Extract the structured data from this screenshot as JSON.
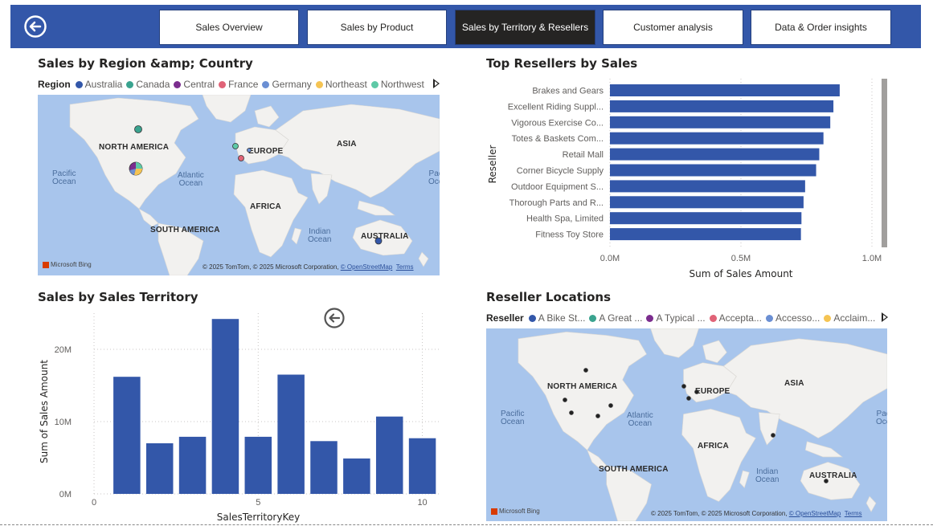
{
  "nav": {
    "tabs": [
      {
        "label": "Sales Overview",
        "active": false
      },
      {
        "label": "Sales by Product",
        "active": false
      },
      {
        "label": "Sales by Territory & Resellers",
        "active": true
      },
      {
        "label": "Customer analysis",
        "active": false
      },
      {
        "label": "Data & Order insights",
        "active": false
      }
    ],
    "colors": {
      "bar": "#3357a9",
      "active_tab": "#252423"
    }
  },
  "region_map": {
    "title": "Sales by Region &amp; Country",
    "legend_title": "Region",
    "legend": [
      {
        "label": "Australia",
        "color": "#3357a9"
      },
      {
        "label": "Canada",
        "color": "#3aa38f"
      },
      {
        "label": "Central",
        "color": "#7b2d8e"
      },
      {
        "label": "France",
        "color": "#e06377"
      },
      {
        "label": "Germany",
        "color": "#6b8fd3"
      },
      {
        "label": "Northeast",
        "color": "#f5c453"
      },
      {
        "label": "Northwest",
        "color": "#5ec9a6"
      }
    ],
    "labels": {
      "north_america": "NORTH AMERICA",
      "europe": "EUROPE",
      "asia": "ASIA",
      "africa": "AFRICA",
      "south_america": "SOUTH AMERICA",
      "australia": "AUSTRALIA"
    },
    "oceans": {
      "pacific": "Pacific\nOcean",
      "atlantic": "Atlantic\nOcean",
      "indian": "Indian\nOcean",
      "pacific_right": "Pac\nOce"
    },
    "bing": "Microsoft Bing",
    "copyright": "© 2025 TomTom, © 2025 Microsoft Corporation,",
    "osm": "© OpenStreetMap",
    "terms": "Terms"
  },
  "resellers_chart": {
    "title": "Top Resellers by Sales",
    "chart_data": {
      "type": "bar",
      "orientation": "horizontal",
      "categories": [
        "Brakes and Gears",
        "Excellent Riding Suppl...",
        "Vigorous Exercise Co...",
        "Totes & Baskets Com...",
        "Retail Mall",
        "Corner Bicycle Supply",
        "Outdoor Equipment S...",
        "Thorough Parts and R...",
        "Health Spa, Limited",
        "Fitness Toy Store"
      ],
      "values": [
        0.877,
        0.853,
        0.841,
        0.815,
        0.799,
        0.787,
        0.745,
        0.739,
        0.731,
        0.729
      ],
      "xlabel": "Sum of Sales Amount",
      "ylabel": "Reseller",
      "xlim": [
        0,
        1.0
      ],
      "xticks": [
        "0.0M",
        "0.5M",
        "1.0M"
      ],
      "grid": true,
      "color": "#3357a9"
    }
  },
  "territory_chart": {
    "title": "Sales by Sales Territory",
    "chart_data": {
      "type": "bar",
      "x": [
        1,
        2,
        3,
        4,
        5,
        6,
        7,
        8,
        9,
        10
      ],
      "values": [
        16.2,
        7.0,
        7.9,
        24.2,
        7.9,
        16.5,
        7.3,
        4.9,
        10.7,
        7.7
      ],
      "xlabel": "SalesTerritoryKey",
      "ylabel": "Sum of Sales Amount",
      "ylim": [
        0,
        25
      ],
      "yticks": [
        "0M",
        "10M",
        "20M"
      ],
      "xticks": [
        "0",
        "5",
        "10"
      ],
      "grid": true,
      "color": "#3357a9"
    }
  },
  "reseller_map": {
    "title": "Reseller Locations",
    "legend_title": "Reseller",
    "legend": [
      {
        "label": "A Bike St...",
        "color": "#3357a9"
      },
      {
        "label": "A Great ...",
        "color": "#3aa38f"
      },
      {
        "label": "A Typical ...",
        "color": "#7b2d8e"
      },
      {
        "label": "Accepta...",
        "color": "#e06377"
      },
      {
        "label": "Accesso...",
        "color": "#6b8fd3"
      },
      {
        "label": "Acclaim...",
        "color": "#f5c453"
      }
    ]
  }
}
